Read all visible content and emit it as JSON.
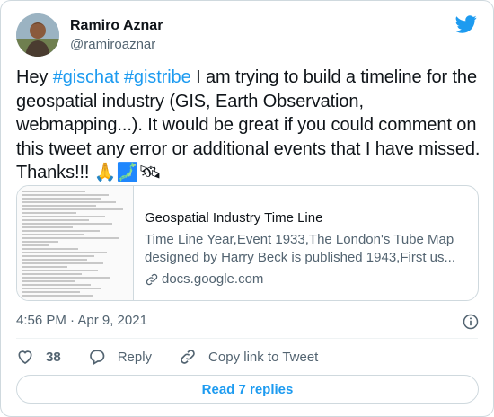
{
  "author": {
    "name": "Ramiro Aznar",
    "handle": "@ramiroaznar"
  },
  "tweet": {
    "lines": [
      [
        {
          "t": "Hey ",
          "tag": false
        },
        {
          "t": "#gischat",
          "tag": true
        },
        {
          "t": " ",
          "tag": false
        },
        {
          "t": "#gistribe",
          "tag": true
        },
        {
          "t": " I am trying to build a timeline for the",
          "tag": false
        }
      ],
      [
        {
          "t": "geospatial industry (GIS, Earth Observation,",
          "tag": false
        }
      ],
      [
        {
          "t": "webmapping...). It would be great if you could comment on",
          "tag": false
        }
      ],
      [
        {
          "t": "this tweet any error or additional events that I have missed.",
          "tag": false
        }
      ],
      [
        {
          "t": "Thanks!!! 🙏🗾🛰",
          "tag": false
        }
      ]
    ]
  },
  "link_card": {
    "title": "Geospatial Industry Time Line",
    "description_line1": "Time Line Year,Event 1933,The London's Tube Map",
    "description_line2": "designed by Harry Beck is published 1943,First us...",
    "domain": "docs.google.com"
  },
  "timestamp": "4:56 PM · Apr 9, 2021",
  "actions": {
    "like_count": "38",
    "reply_label": "Reply",
    "copy_label": "Copy link to Tweet"
  },
  "read_replies_label": "Read 7 replies",
  "colors": {
    "accent": "#1d9bf0",
    "like": "#536471"
  }
}
